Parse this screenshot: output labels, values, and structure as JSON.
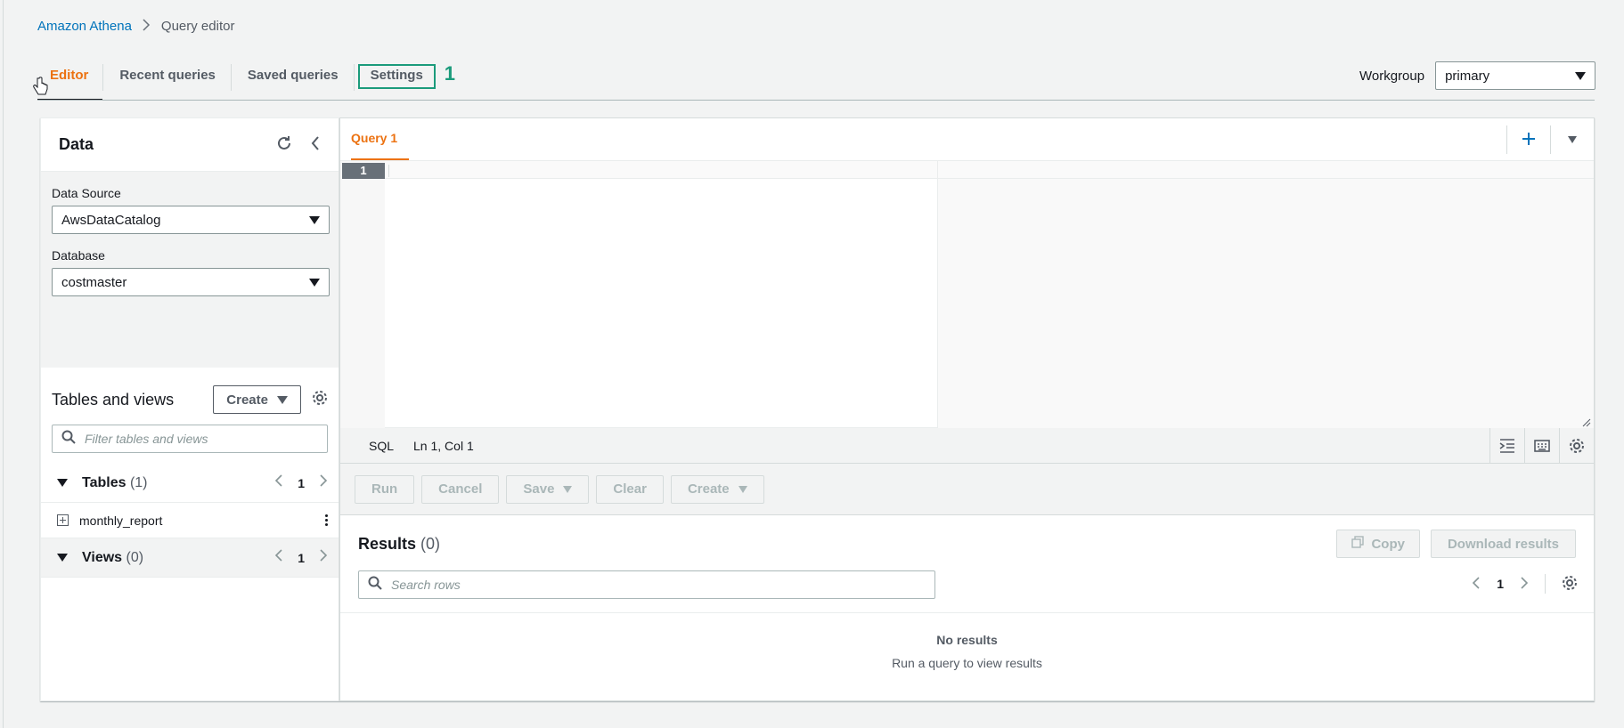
{
  "breadcrumb": {
    "root": "Amazon Athena",
    "current": "Query editor"
  },
  "tabs": {
    "editor": "Editor",
    "recent": "Recent queries",
    "saved": "Saved queries",
    "settings": "Settings",
    "annotation": "1"
  },
  "workgroup": {
    "label": "Workgroup",
    "value": "primary"
  },
  "data_panel": {
    "title": "Data",
    "data_source_label": "Data Source",
    "data_source_value": "AwsDataCatalog",
    "database_label": "Database",
    "database_value": "costmaster",
    "tables_views_title": "Tables and views",
    "create_label": "Create",
    "filter_placeholder": "Filter tables and views",
    "tables_label": "Tables",
    "tables_count": "(1)",
    "tables_page": "1",
    "tables": [
      {
        "name": "monthly_report"
      }
    ],
    "views_label": "Views",
    "views_count": "(0)",
    "views_page": "1"
  },
  "query": {
    "tab_label": "Query 1",
    "line_number": "1",
    "language": "SQL",
    "position": "Ln 1, Col 1"
  },
  "actions": {
    "run": "Run",
    "cancel": "Cancel",
    "save": "Save",
    "clear": "Clear",
    "create": "Create"
  },
  "results": {
    "title": "Results",
    "count": "(0)",
    "copy": "Copy",
    "download": "Download results",
    "search_placeholder": "Search rows",
    "page": "1",
    "empty_title": "No results",
    "empty_subtitle": "Run a query to view results"
  },
  "colors": {
    "accent": "#ec7211",
    "link": "#0073bb",
    "annotation": "#1b9b7b"
  }
}
